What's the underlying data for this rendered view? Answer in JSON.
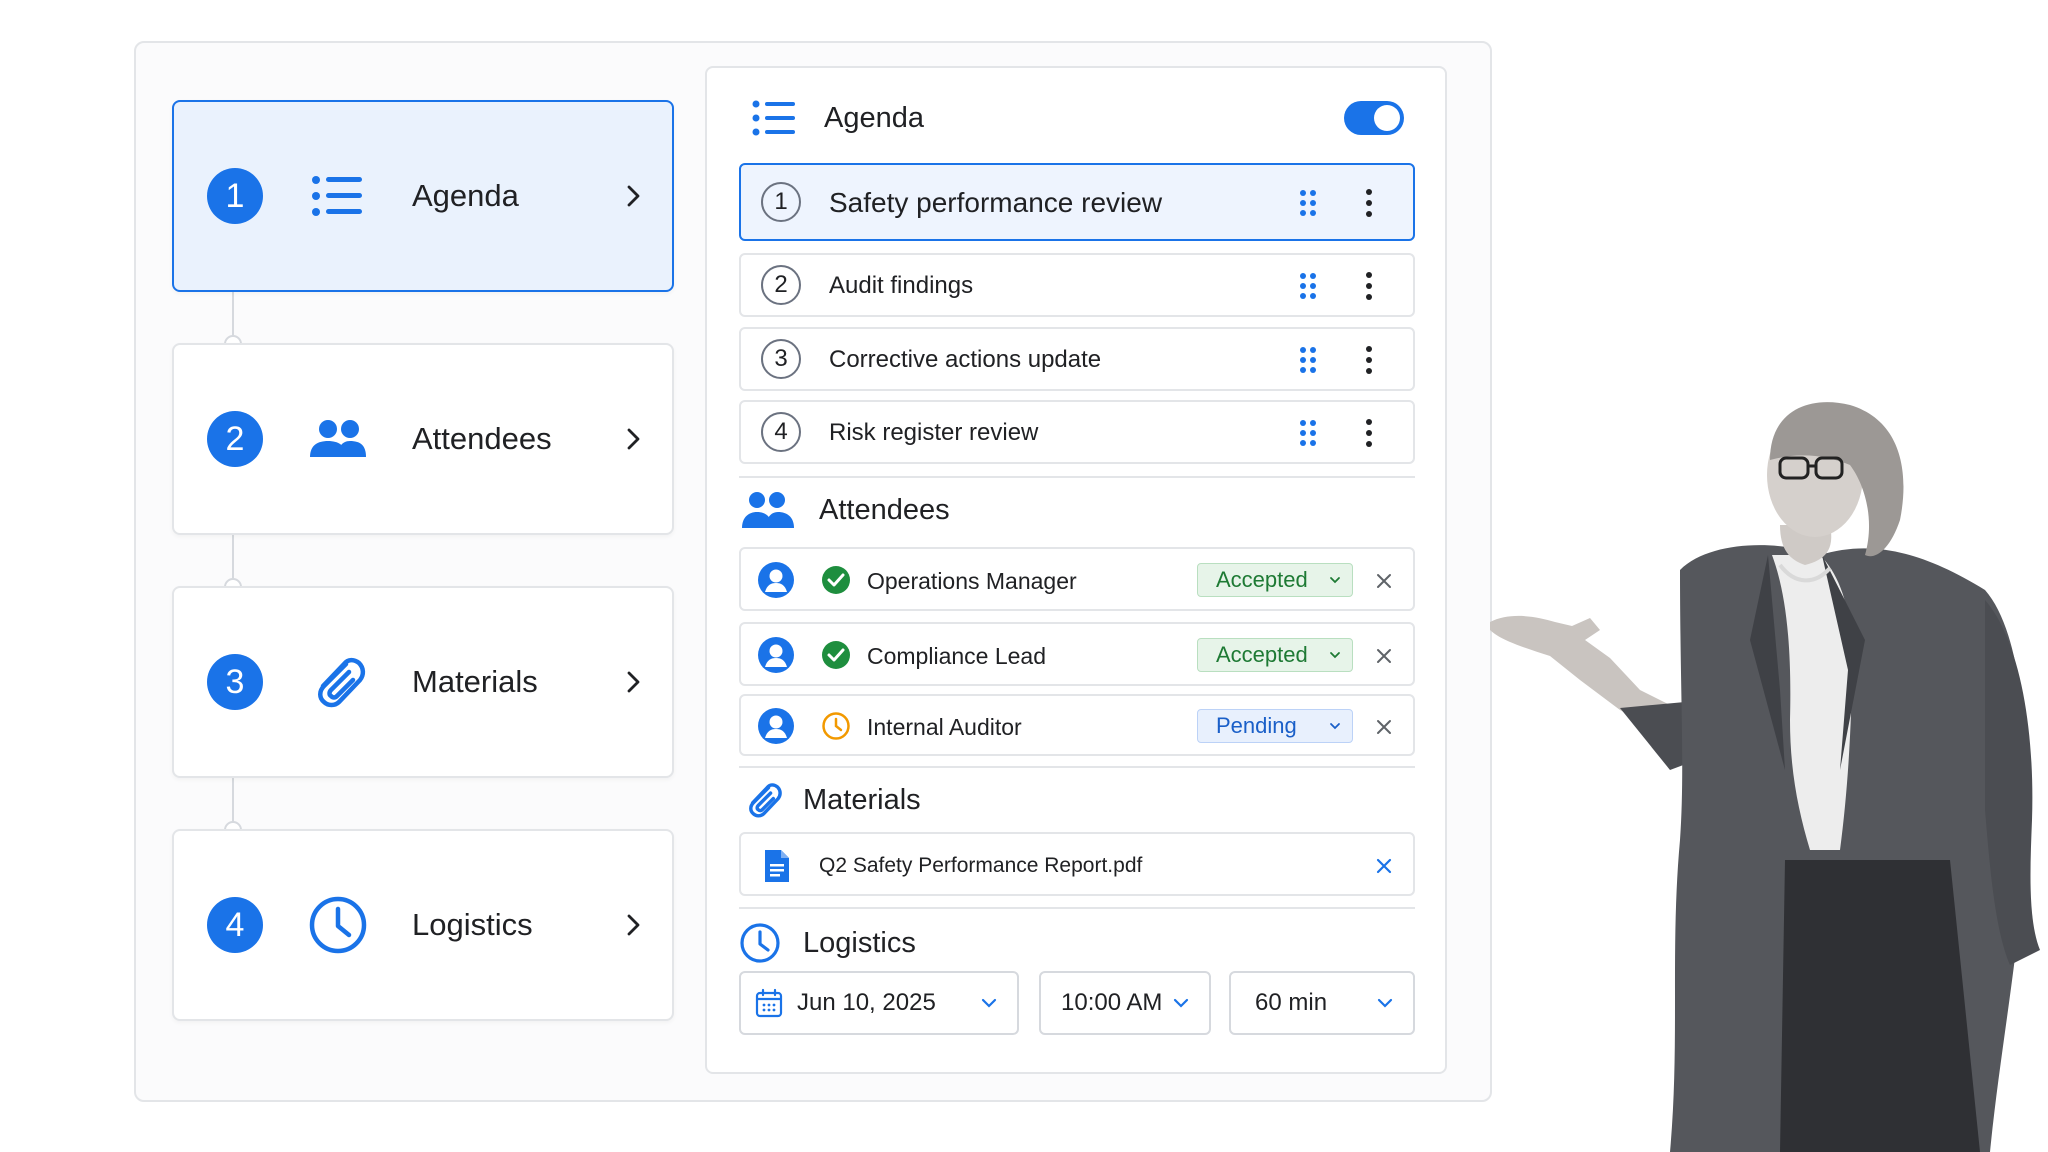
{
  "steps": [
    {
      "number": "1",
      "label": "Agenda",
      "icon": "list-icon",
      "active": true
    },
    {
      "number": "2",
      "label": "Attendees",
      "icon": "people-icon",
      "active": false
    },
    {
      "number": "3",
      "label": "Materials",
      "icon": "paperclip-icon",
      "active": false
    },
    {
      "number": "4",
      "label": "Logistics",
      "icon": "clock-icon",
      "active": false
    }
  ],
  "agenda": {
    "title": "Agenda",
    "toggle_on": true,
    "items": [
      {
        "number": "1",
        "title": "Safety performance review"
      },
      {
        "number": "2",
        "title": "Audit findings"
      },
      {
        "number": "3",
        "title": "Corrective actions update"
      },
      {
        "number": "4",
        "title": "Risk register review"
      }
    ]
  },
  "attendees": {
    "title": "Attendees",
    "people": [
      {
        "name": "Operations Manager",
        "status": "Accepted",
        "status_icon": "check-circle-icon"
      },
      {
        "name": "Compliance Lead",
        "status": "Accepted",
        "status_icon": "check-circle-icon"
      },
      {
        "name": "Internal Auditor",
        "status": "Pending",
        "status_icon": "clock-icon"
      }
    ]
  },
  "materials": {
    "title": "Materials",
    "files": [
      {
        "name": "Q2 Safety Performance Report.pdf",
        "icon": "document-icon"
      }
    ]
  },
  "logistics": {
    "title": "Logistics",
    "date": "Jun 10, 2025",
    "time": "10:00 AM",
    "duration": "60 min"
  },
  "colors": {
    "accent": "#1a73e8",
    "accepted": "#1e7a34",
    "pending": "#1a5fc8",
    "pending_icon": "#f29900"
  }
}
